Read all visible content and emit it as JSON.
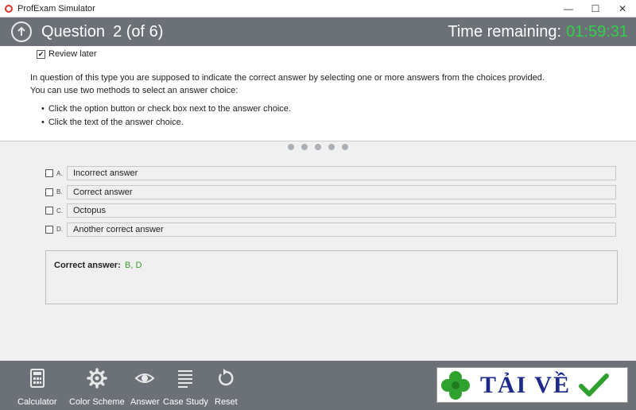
{
  "window": {
    "title": "ProfExam Simulator",
    "minimize": "—",
    "maximize": "☐",
    "close": "✕"
  },
  "header": {
    "question_label": "Question",
    "question_number": "2 (of 6)",
    "timer_label": "Time remaining:",
    "timer_value": "01:59:31"
  },
  "question": {
    "review_label": "Review later",
    "review_checked": "✔",
    "line1": "In question of this type you are supposed to  indicate the correct answer by selecting one or more answers from the choices provided.",
    "line2": "You can use two methods to select an answer choice:",
    "bullets": [
      "Click the option button or check box next to the answer choice.",
      "Click the text of the answer choice."
    ]
  },
  "choices": [
    {
      "letter": "A.",
      "text": "Incorrect answer"
    },
    {
      "letter": "B.",
      "text": "Correct answer"
    },
    {
      "letter": "C.",
      "text": "Octopus"
    },
    {
      "letter": "D.",
      "text": "Another correct answer"
    }
  ],
  "answer": {
    "label": "Correct answer:",
    "value": "B, D"
  },
  "footer": {
    "calculator": "Calculator",
    "color_scheme": "Color Scheme",
    "answer": "Answer",
    "case_study": "Case Study",
    "reset": "Reset"
  },
  "logo": {
    "text": "TẢI VỀ"
  },
  "colors": {
    "header_bg": "#6b7177",
    "timer": "#2fd14a",
    "answer_value": "#3a9a2a"
  }
}
